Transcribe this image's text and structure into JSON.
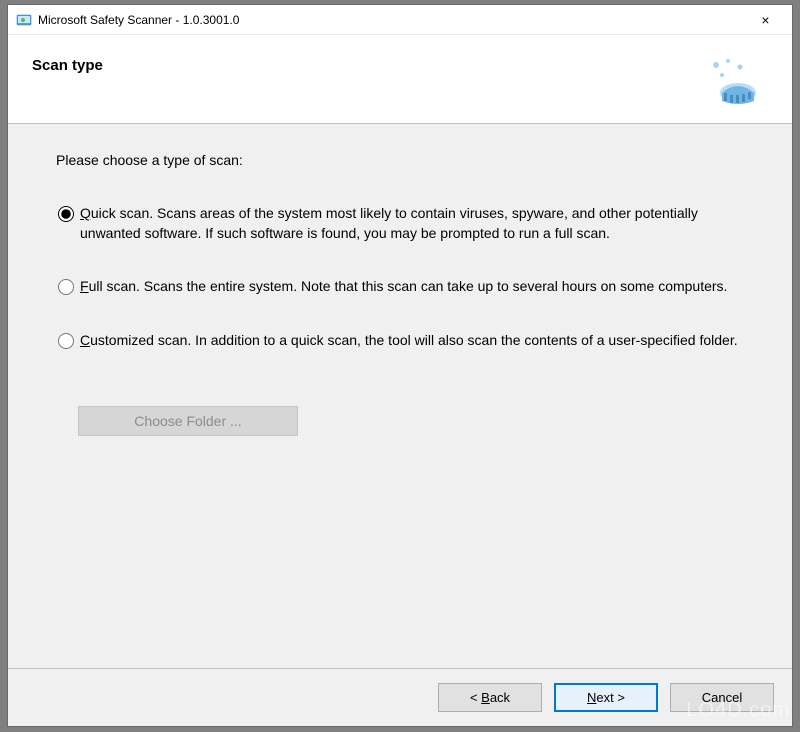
{
  "titlebar": {
    "title": "Microsoft Safety Scanner - 1.0.3001.0",
    "close_symbol": "×"
  },
  "header": {
    "title": "Scan type"
  },
  "content": {
    "prompt": "Please choose a type of scan:",
    "options": [
      {
        "accel": "Q",
        "rest": "uick scan. Scans areas of the system most likely to contain viruses, spyware, and other potentially unwanted software. If such software is found, you may be prompted to run a full scan.",
        "checked": true
      },
      {
        "accel": "F",
        "rest": "ull scan. Scans the entire system. Note that this scan can take up to several hours on some computers.",
        "checked": false
      },
      {
        "accel": "C",
        "rest": "ustomized scan. In addition to a quick scan, the tool will also scan the contents of a user-specified folder.",
        "checked": false
      }
    ],
    "choose_folder_label": "Choose Folder ..."
  },
  "footer": {
    "back_prefix": "< ",
    "back_accel": "B",
    "back_rest": "ack",
    "next_accel": "N",
    "next_rest": "ext >",
    "cancel_label": "Cancel"
  },
  "watermark": "LO4D.com"
}
